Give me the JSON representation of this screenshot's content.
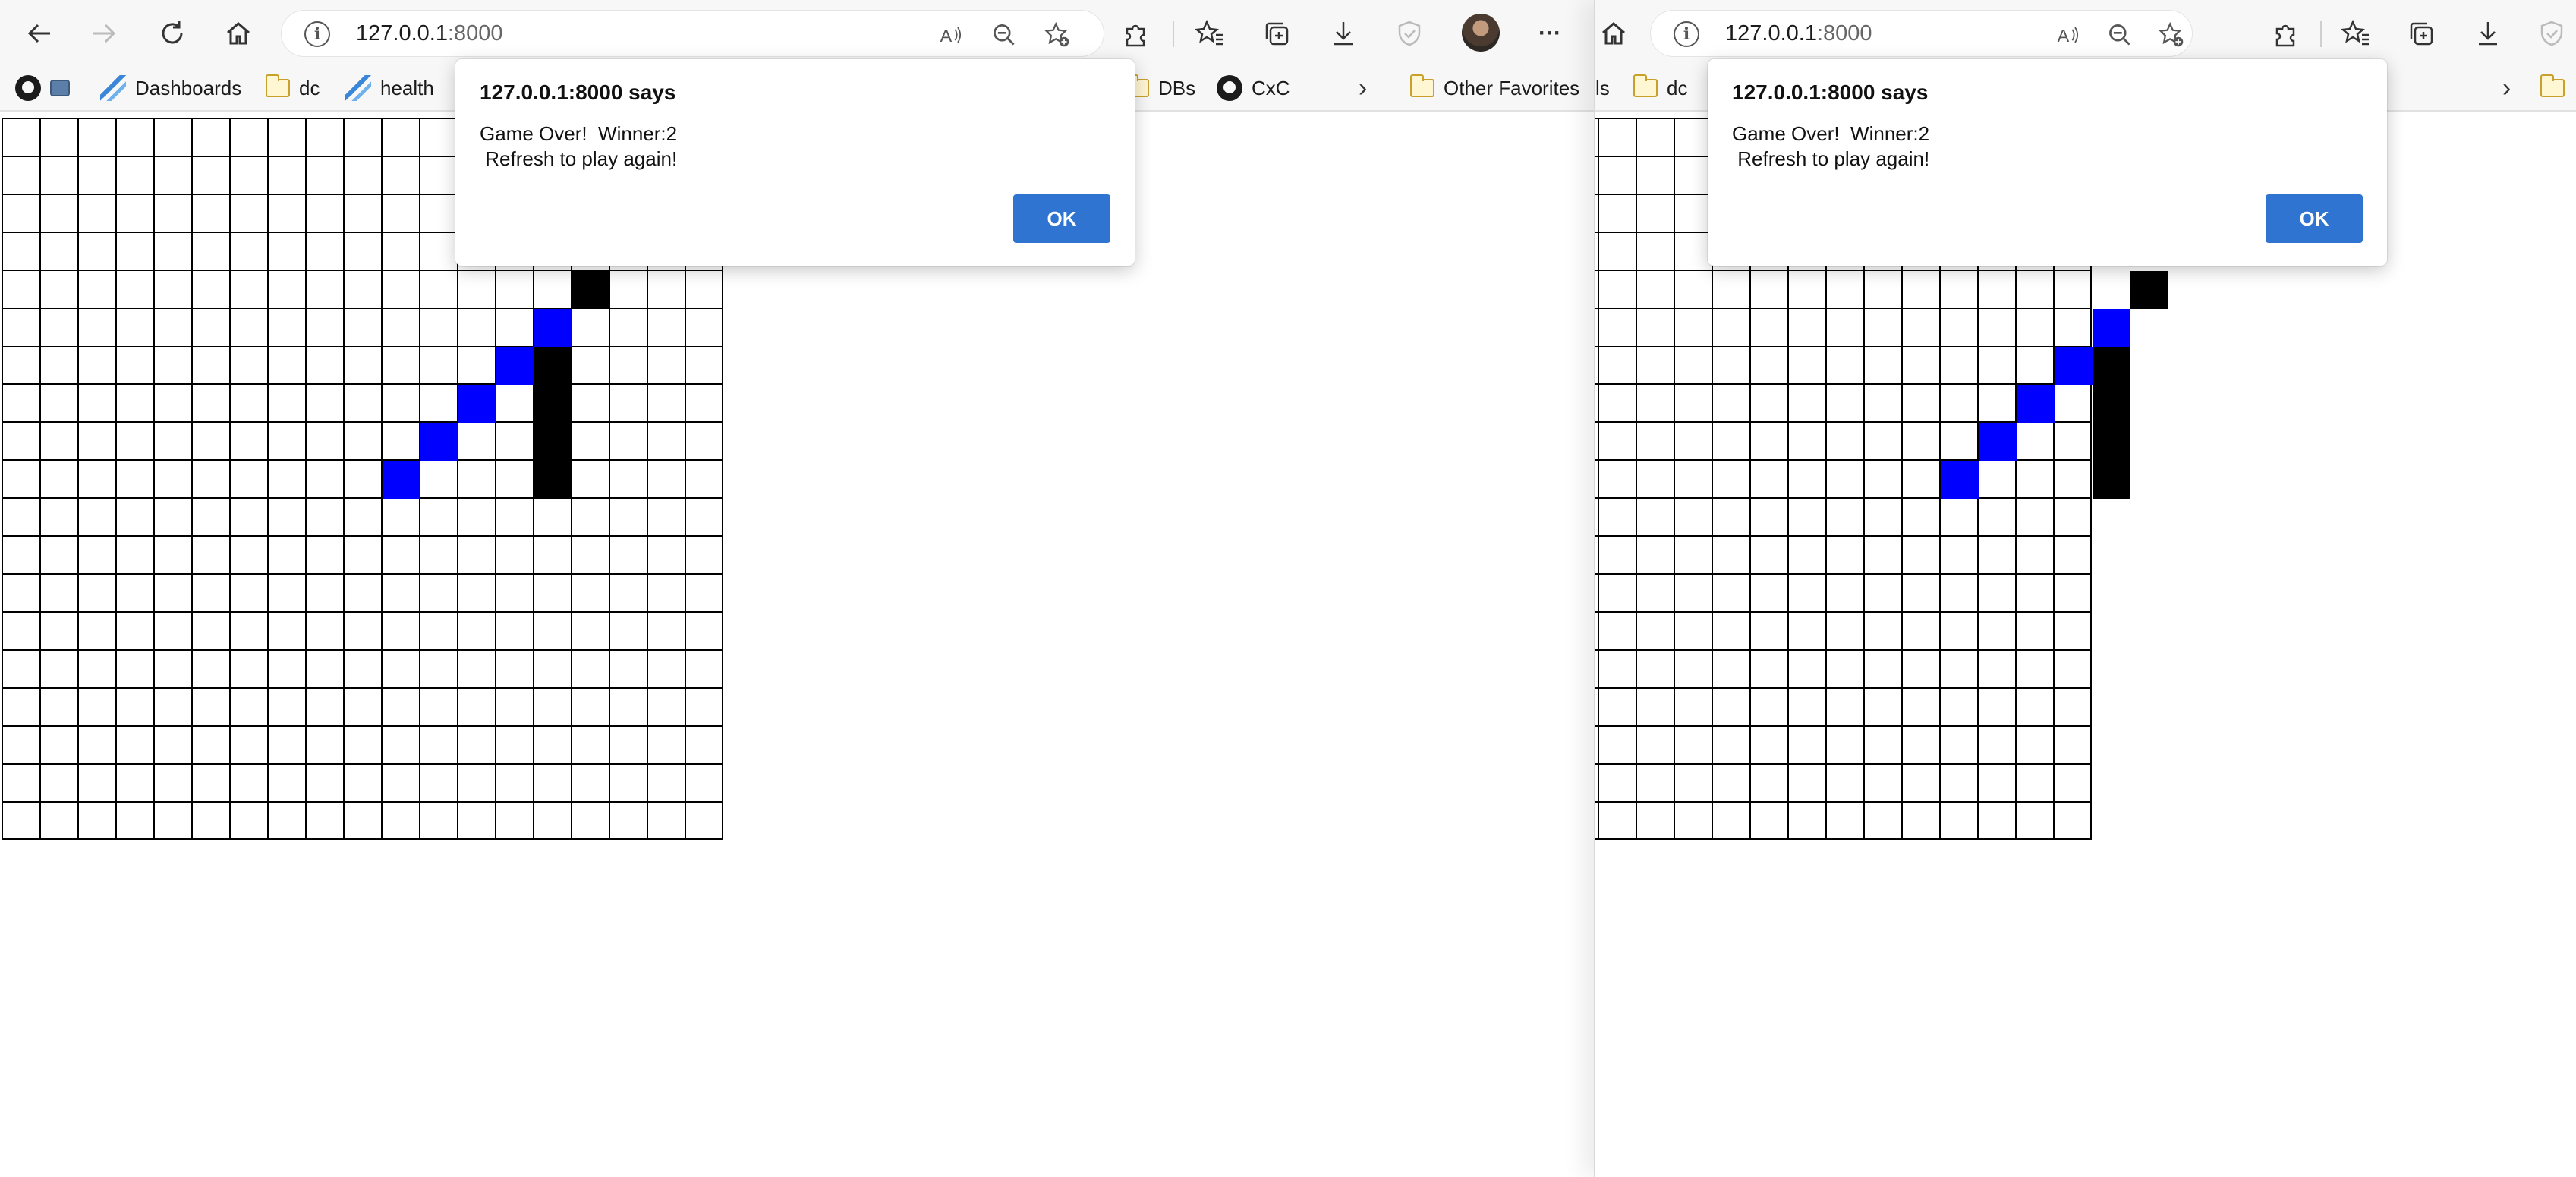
{
  "browser": {
    "url_host": "127.0.0.1",
    "url_port": ":8000",
    "menu_glyph": "···",
    "more_bookmarks_glyph": "›"
  },
  "bookmarks": {
    "dashboards": "Dashboards",
    "dc": "dc",
    "health": "health",
    "dbs": "DBs",
    "cxc": "CxC",
    "other_favorites": "Other Favorites",
    "right_partial": "ls"
  },
  "dialog": {
    "title": "127.0.0.1:8000 says",
    "message": "Game Over!  Winner:2\n Refresh to play again!",
    "ok_label": "OK"
  },
  "game": {
    "player_colors": {
      "1": "#0000ff",
      "2": "#000000"
    },
    "winner": 2,
    "stones": [
      {
        "col": 10,
        "row": 9,
        "player": 1
      },
      {
        "col": 11,
        "row": 8,
        "player": 1
      },
      {
        "col": 12,
        "row": 7,
        "player": 1
      },
      {
        "col": 13,
        "row": 6,
        "player": 1
      },
      {
        "col": 14,
        "row": 5,
        "player": 1
      },
      {
        "col": 15,
        "row": 4,
        "player": 2
      },
      {
        "col": 14,
        "row": 6,
        "player": 2
      },
      {
        "col": 14,
        "row": 7,
        "player": 2
      },
      {
        "col": 14,
        "row": 8,
        "player": 2
      },
      {
        "col": 14,
        "row": 9,
        "player": 2
      }
    ]
  }
}
